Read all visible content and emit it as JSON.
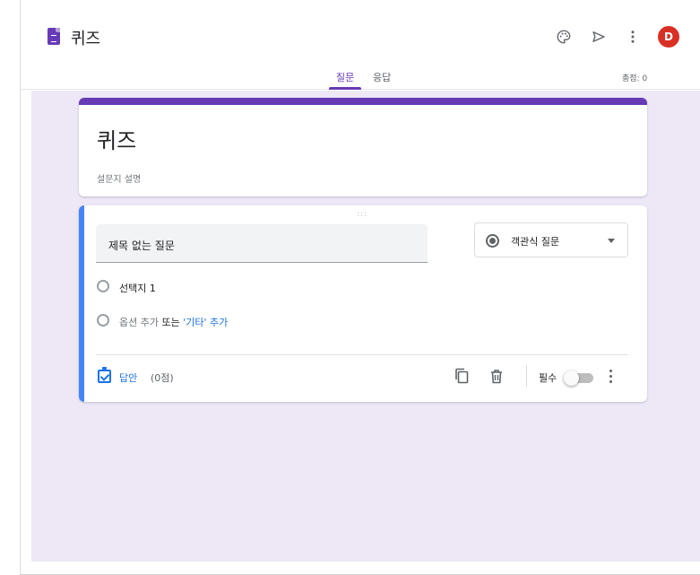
{
  "header": {
    "form_name": "퀴즈",
    "avatar_initial": "D"
  },
  "tabs": [
    {
      "label": "질문",
      "active": true
    },
    {
      "label": "응답",
      "active": false
    }
  ],
  "total_points": "총점: 0",
  "form": {
    "title": "퀴즈",
    "description": "설문지 설명"
  },
  "question": {
    "drag_handle": ":::",
    "title": "제목 없는 질문",
    "type": "객관식 질문",
    "option_1": "선택지 1",
    "add_option": "옵션 추가",
    "or": "또는",
    "add_other": "'기타' 추가",
    "answer_label": "답안",
    "points": "(0점)",
    "required_label": "필수",
    "required": false
  },
  "colors": {
    "accent": "#673ab7",
    "active_border": "#4285f4",
    "link": "#1a73e8",
    "avatar": "#d93025",
    "background": "#ede7f6"
  },
  "icons": [
    "form-doc-icon",
    "palette-icon",
    "send-icon",
    "more-vert-icon",
    "radio-icon",
    "answer-key-icon",
    "copy-icon",
    "trash-icon"
  ]
}
